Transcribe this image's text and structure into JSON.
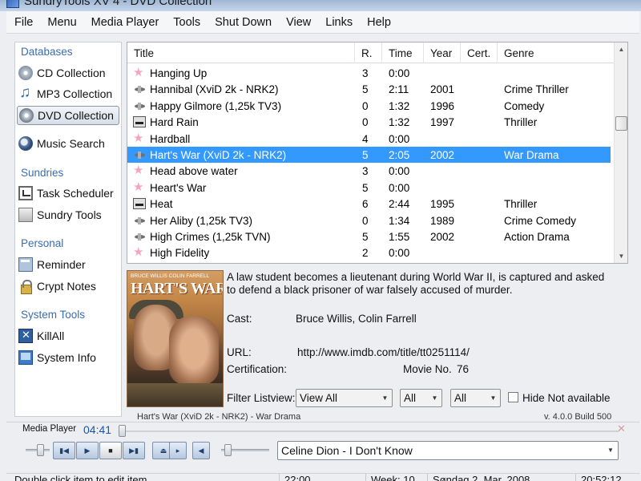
{
  "window": {
    "title": "SundryTools XV 4 - DVD Collection"
  },
  "menu": [
    "File",
    "Menu",
    "Media Player",
    "Tools",
    "Shut Down",
    "View",
    "Links",
    "Help"
  ],
  "sidebar": {
    "sections": [
      {
        "header": "Databases",
        "items": [
          {
            "label": "CD Collection",
            "icon": "cd-icon"
          },
          {
            "label": "MP3 Collection",
            "icon": "music-note-icon"
          },
          {
            "label": "DVD Collection",
            "icon": "dvd-icon",
            "selected": true
          },
          {
            "label": "Music Search",
            "icon": "music-search-icon"
          }
        ]
      },
      {
        "header": "Sundries",
        "items": [
          {
            "label": "Task Scheduler",
            "icon": "task-scheduler-icon"
          },
          {
            "label": "Sundry Tools",
            "icon": "sundry-tools-icon"
          }
        ]
      },
      {
        "header": "Personal",
        "items": [
          {
            "label": "Reminder",
            "icon": "reminder-icon"
          },
          {
            "label": "Crypt Notes",
            "icon": "lock-icon"
          }
        ]
      },
      {
        "header": "System Tools",
        "items": [
          {
            "label": "KillAll",
            "icon": "killall-icon"
          },
          {
            "label": "System Info",
            "icon": "system-info-icon"
          }
        ]
      }
    ]
  },
  "list": {
    "columns": [
      "Title",
      "R.",
      "Time",
      "Year",
      "Cert.",
      "Genre"
    ],
    "rows": [
      {
        "icon": "star-icon",
        "title": "Hanging Up",
        "rating": "3",
        "time": "0:00",
        "year": "",
        "cert": "",
        "genre": ""
      },
      {
        "icon": "satellite-icon",
        "title": "Hannibal (XviD 2k - NRK2)",
        "rating": "5",
        "time": "2:11",
        "year": "2001",
        "cert": "",
        "genre": "Crime Thriller"
      },
      {
        "icon": "satellite-icon",
        "title": "Happy Gilmore (1,25k TV3)",
        "rating": "0",
        "time": "1:32",
        "year": "1996",
        "cert": "",
        "genre": "Comedy"
      },
      {
        "icon": "dvd-disc-icon",
        "title": "Hard Rain",
        "rating": "0",
        "time": "1:32",
        "year": "1997",
        "cert": "",
        "genre": "Thriller"
      },
      {
        "icon": "star-icon",
        "title": "Hardball",
        "rating": "4",
        "time": "0:00",
        "year": "",
        "cert": "",
        "genre": ""
      },
      {
        "icon": "satellite-icon",
        "title": "Hart's War (XviD 2k - NRK2)",
        "rating": "5",
        "time": "2:05",
        "year": "2002",
        "cert": "",
        "genre": "War Drama",
        "selected": true
      },
      {
        "icon": "star-icon",
        "title": "Head above water",
        "rating": "3",
        "time": "0:00",
        "year": "",
        "cert": "",
        "genre": ""
      },
      {
        "icon": "star-icon",
        "title": "Heart's War",
        "rating": "5",
        "time": "0:00",
        "year": "",
        "cert": "",
        "genre": ""
      },
      {
        "icon": "dvd-disc-icon",
        "title": "Heat",
        "rating": "6",
        "time": "2:44",
        "year": "1995",
        "cert": "",
        "genre": "Thriller"
      },
      {
        "icon": "satellite-icon",
        "title": "Her Aliby (1,25k TV3)",
        "rating": "0",
        "time": "1:34",
        "year": "1989",
        "cert": "",
        "genre": "Crime Comedy"
      },
      {
        "icon": "satellite-icon",
        "title": "High Crimes (1,25k TVN)",
        "rating": "5",
        "time": "1:55",
        "year": "2002",
        "cert": "",
        "genre": "Action Drama"
      },
      {
        "icon": "star-icon",
        "title": "High Fidelity",
        "rating": "2",
        "time": "0:00",
        "year": "",
        "cert": "",
        "genre": ""
      }
    ]
  },
  "poster": {
    "credits": "BRUCE WILLIS   COLIN FARRELL",
    "title": "HART'S WAR"
  },
  "detail": {
    "description": "A law student becomes a lieutenant during World War II, is captured and asked to defend a black prisoner of war falsely accused of murder.",
    "cast_label": "Cast:",
    "cast_value": "Bruce Willis, Colin Farrell",
    "url_label": "URL:",
    "url_value": "http://www.imdb.com/title/tt0251114/",
    "cert_label": "Certification:",
    "movie_no_label": "Movie No.",
    "movie_no_value": "76",
    "caption": "Hart's War (XviD 2k - NRK2) - War Drama",
    "version": "v. 4.0.0 Build 500"
  },
  "filter": {
    "label": "Filter Listview:",
    "view_value": "View All",
    "filter2_value": "All",
    "filter3_value": "All",
    "hide_label": "Hide Not available"
  },
  "player": {
    "label": "Media Player",
    "time": "04:41",
    "now_playing": "Celine Dion - I Don't Know",
    "close_glyph": "✕"
  },
  "status": {
    "hint": "Double click item to edit item.",
    "time_a": "22:00",
    "week": "Week: 10",
    "date": "Søndag 2. Mar. 2008",
    "clock": "20:52:12"
  },
  "colors": {
    "selection": "#3399ff",
    "section_header": "#3a6cb0",
    "time_accent": "#1a55a8"
  }
}
